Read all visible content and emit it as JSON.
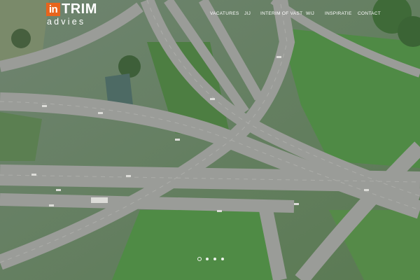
{
  "brand": {
    "logo_prefix": "in",
    "logo_name": "TRIM",
    "logo_sub": "advies",
    "accent_color": "#e8641c"
  },
  "nav": {
    "items": [
      {
        "label": "VACATURES"
      },
      {
        "label": "JIJ"
      },
      {
        "label": "INTERIM OF VAST"
      },
      {
        "label": "WIJ"
      },
      {
        "label": "INSPIRATIE"
      },
      {
        "label": "CONTACT"
      }
    ]
  },
  "slider": {
    "slide_count": 4,
    "active_slide": 1
  },
  "hero": {
    "image_subject": "aerial-highway-interchange"
  }
}
